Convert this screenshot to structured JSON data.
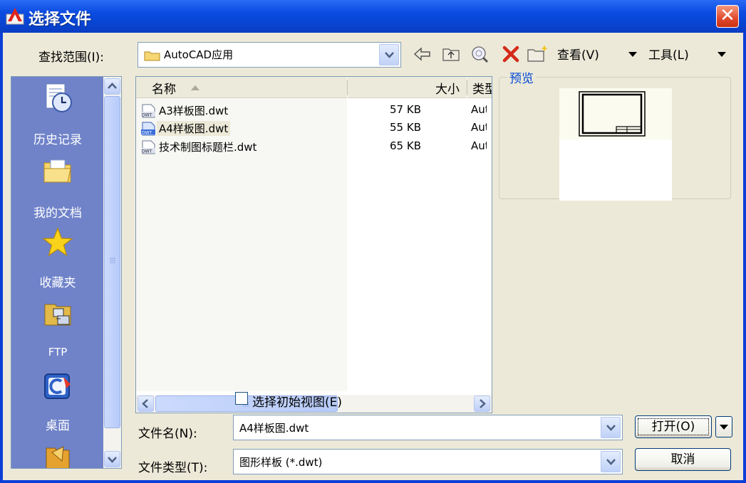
{
  "window": {
    "title": "选择文件",
    "close_label": "✕"
  },
  "look_in": {
    "label": "查找范围(I):",
    "value": "AutoCAD应用"
  },
  "toolbar": {
    "view_label": "查看(V)",
    "tools_label": "工具(L)"
  },
  "places": [
    "历史记录",
    "我的文档",
    "收藏夹",
    "FTP",
    "桌面"
  ],
  "file_list": {
    "headers": {
      "name": "名称",
      "size": "大小",
      "type": "类型"
    },
    "files": [
      {
        "name": "A3样板图.dwt",
        "size": "57 KB",
        "type": "Aut",
        "selected": false
      },
      {
        "name": "A4样板图.dwt",
        "size": "55 KB",
        "type": "Aut",
        "selected": true
      },
      {
        "name": "技术制图标题栏.dwt",
        "size": "65 KB",
        "type": "Aut",
        "selected": false
      }
    ]
  },
  "preview": {
    "label": "预览"
  },
  "initial_view_checkbox": {
    "label": "选择初始视图(E)",
    "checked": false
  },
  "file_name": {
    "label": "文件名(N):",
    "value": "A4样板图.dwt"
  },
  "file_type": {
    "label": "文件类型(T):",
    "value": "图形样板 (*.dwt)"
  },
  "buttons": {
    "open": "打开(O)",
    "cancel": "取消"
  },
  "colors": {
    "titlebar": "#0a4be0",
    "dialog_bg": "#ece9d8",
    "places_bg": "#7083c9",
    "accent_blue": "#0046d5"
  }
}
